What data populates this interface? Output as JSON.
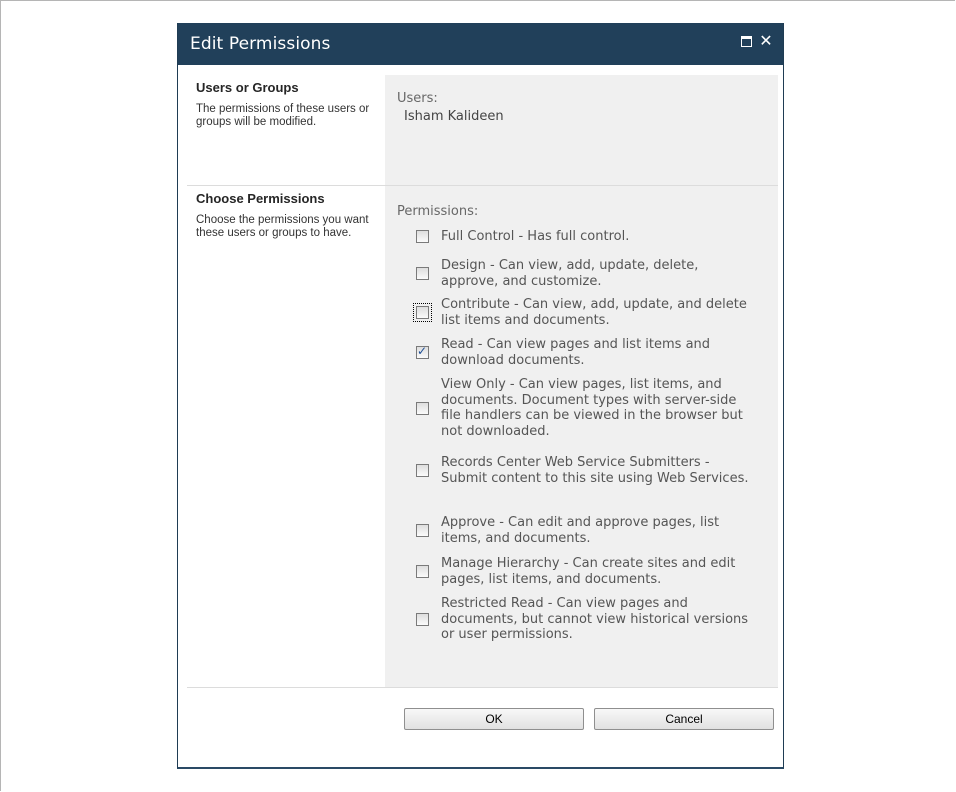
{
  "dialog": {
    "title": "Edit Permissions",
    "maximize_icon": "maximize-icon",
    "close_icon": "close-icon",
    "titlebar_color": "#21405a"
  },
  "users_section": {
    "heading": "Users or Groups",
    "description": "The permissions of these users or groups will be modified.",
    "label": "Users:",
    "user": "Isham Kalideen"
  },
  "permissions_section": {
    "heading": "Choose Permissions",
    "description": "Choose the permissions you want these users or groups to have.",
    "label": "Permissions:",
    "items": [
      {
        "label": "Full Control - Has full control.",
        "checked": false
      },
      {
        "label": "Design - Can view, add, update, delete, approve, and customize.",
        "checked": false
      },
      {
        "label": "Contribute - Can view, add, update, and delete list items and documents.",
        "checked": false,
        "focused": true
      },
      {
        "label": "Read - Can view pages and list items and download documents.",
        "checked": true
      },
      {
        "label": "View Only - Can view pages, list items, and documents. Document types with server-side file handlers can be viewed in the browser but not downloaded.",
        "checked": false
      },
      {
        "label": "Records Center Web Service Submitters - Submit content to this site using Web Services.",
        "checked": false
      },
      {
        "label": "Approve - Can edit and approve pages, list items, and documents.",
        "checked": false
      },
      {
        "label": "Manage Hierarchy - Can create sites and edit pages, list items, and documents.",
        "checked": false
      },
      {
        "label": "Restricted Read - Can view pages and documents, but cannot view historical versions or user permissions.",
        "checked": false
      }
    ]
  },
  "buttons": {
    "ok": "OK",
    "cancel": "Cancel"
  }
}
